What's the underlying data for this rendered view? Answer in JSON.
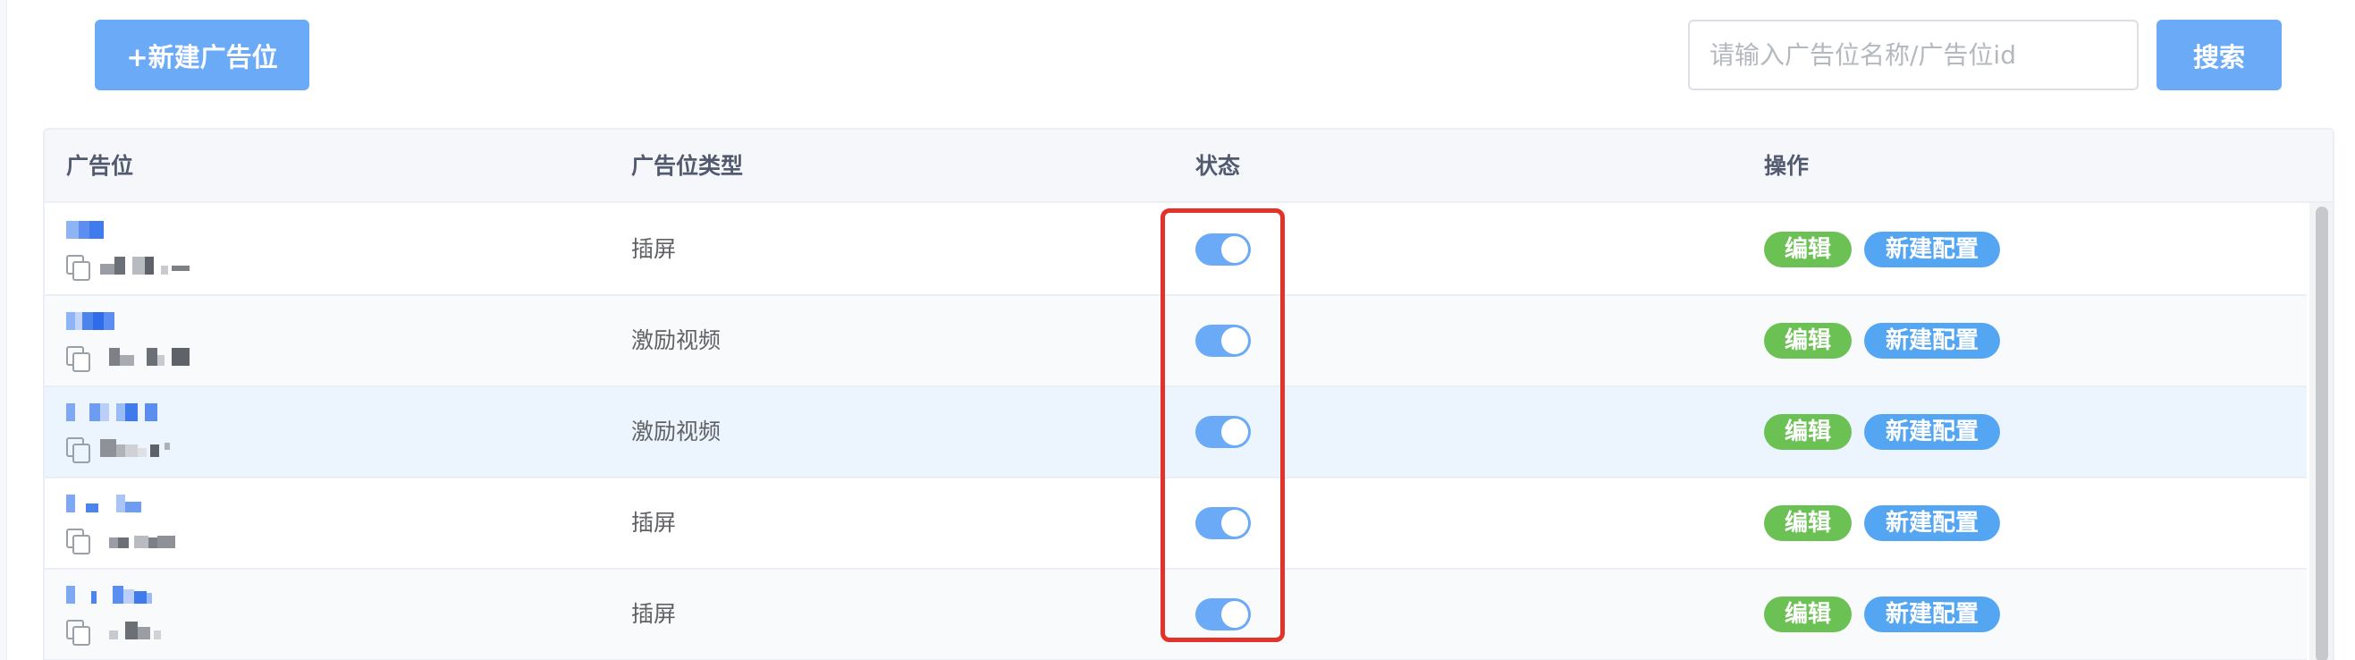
{
  "toolbar": {
    "new_button_label": "+新建广告位",
    "search_placeholder": "请输入广告位名称/广告位id",
    "search_button_label": "搜索"
  },
  "table": {
    "columns": [
      "广告位",
      "广告位类型",
      "状态",
      "操作"
    ],
    "rows": [
      {
        "type": "插屏",
        "status": "on",
        "actions": [
          "编辑",
          "新建配置"
        ]
      },
      {
        "type": "激励视频",
        "status": "on",
        "actions": [
          "编辑",
          "新建配置"
        ]
      },
      {
        "type": "激励视频",
        "status": "on",
        "actions": [
          "编辑",
          "新建配置"
        ]
      },
      {
        "type": "插屏",
        "status": "on",
        "actions": [
          "编辑",
          "新建配置"
        ]
      },
      {
        "type": "插屏",
        "status": "on",
        "actions": [
          "编辑",
          "新建配置"
        ]
      }
    ]
  },
  "colors": {
    "primary": "#6aaaf7",
    "edit_tag": "#6cc155",
    "config_tag": "#55a6f2",
    "annotation": "#e2322a",
    "row_highlight": "#ecf5fe"
  },
  "icons": {
    "copy": "copy-icon",
    "status_switch": "toggle-switch"
  }
}
